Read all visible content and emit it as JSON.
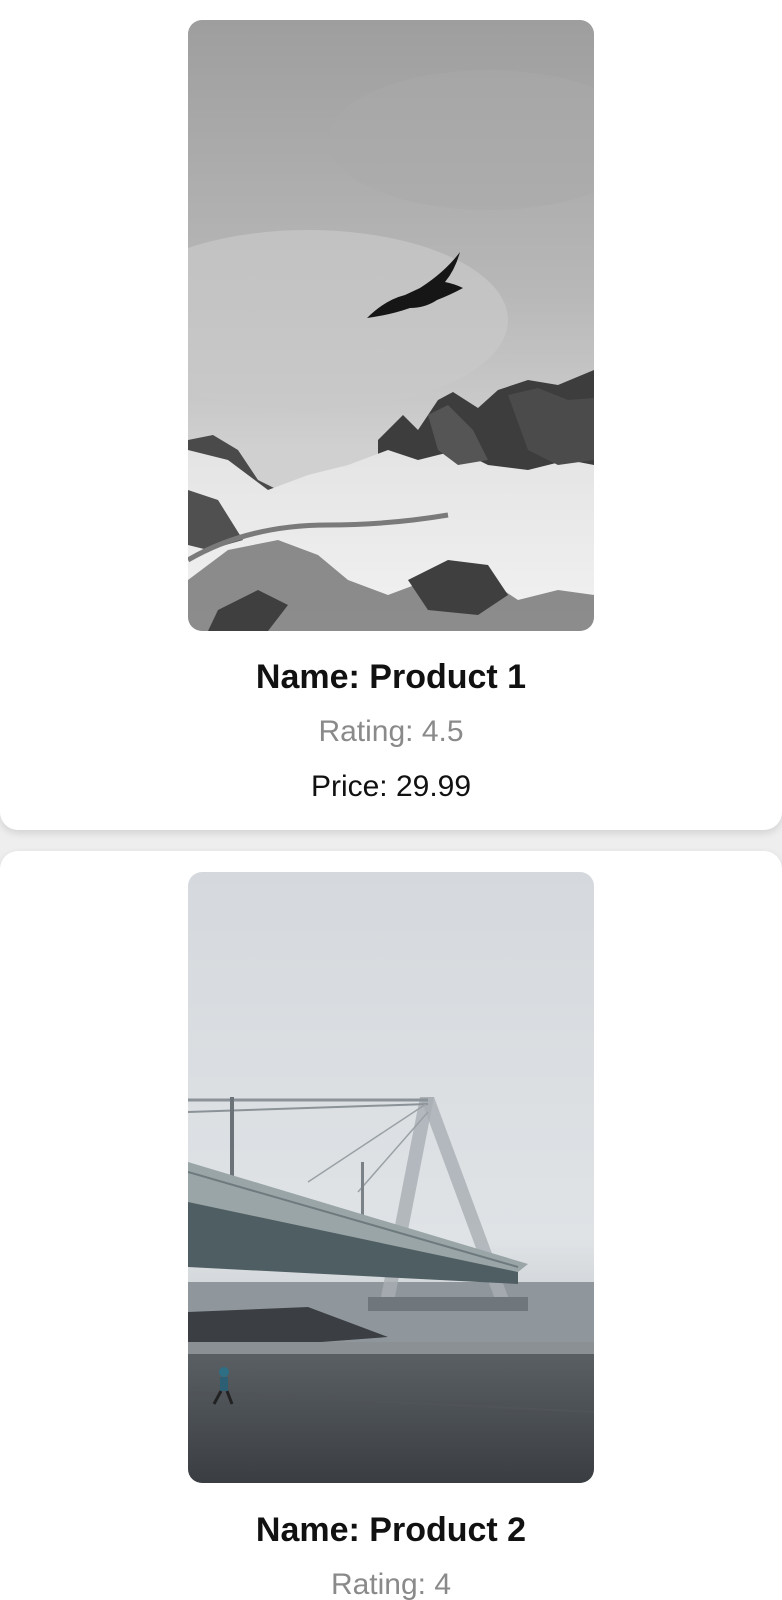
{
  "products": [
    {
      "name": "Name: Product 1",
      "rating": "Rating: 4.5",
      "price": "Price: 29.99",
      "image_subject": "eagle-over-snowy-mountain"
    },
    {
      "name": "Name: Product 2",
      "rating": "Rating: 4",
      "image_subject": "foggy-bridge"
    }
  ],
  "colors": {
    "card_background": "#ffffff",
    "page_background": "#eeeeee",
    "name_text": "#111111",
    "rating_text": "#8a8a8a",
    "price_text": "#111111"
  }
}
